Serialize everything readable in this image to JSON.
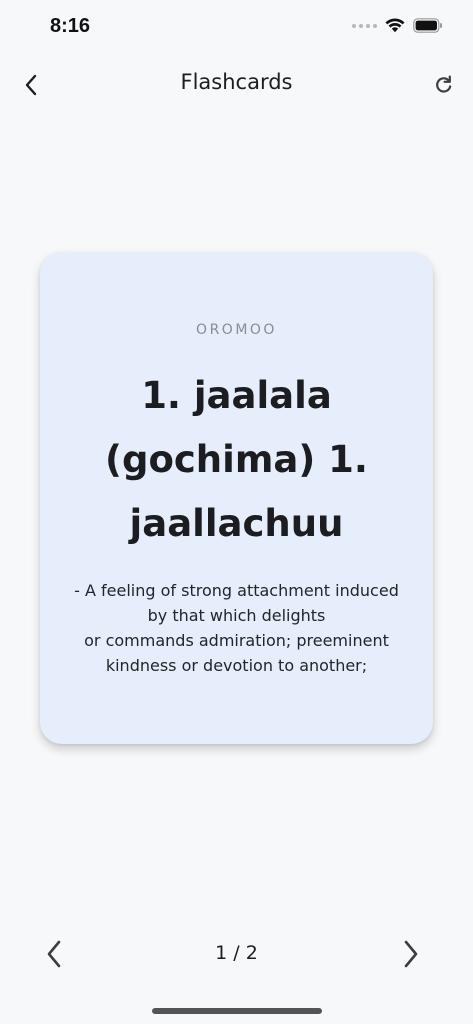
{
  "status_bar": {
    "time": "8:16"
  },
  "header": {
    "title": "Flashcards",
    "back_icon": "chevron-left-icon",
    "refresh_icon": "refresh-icon"
  },
  "card": {
    "language": "OROMOO",
    "term": "1. jaalala (gochima) 1. jaallachuu",
    "definition": "- A feeling of strong attachment induced by that which delights\n or commands admiration; preeminent kindness or devotion to another;",
    "background_color": "#e6eefb"
  },
  "navigation": {
    "counter": "1 / 2",
    "prev_icon": "chevron-left-icon",
    "next_icon": "chevron-right-icon"
  }
}
